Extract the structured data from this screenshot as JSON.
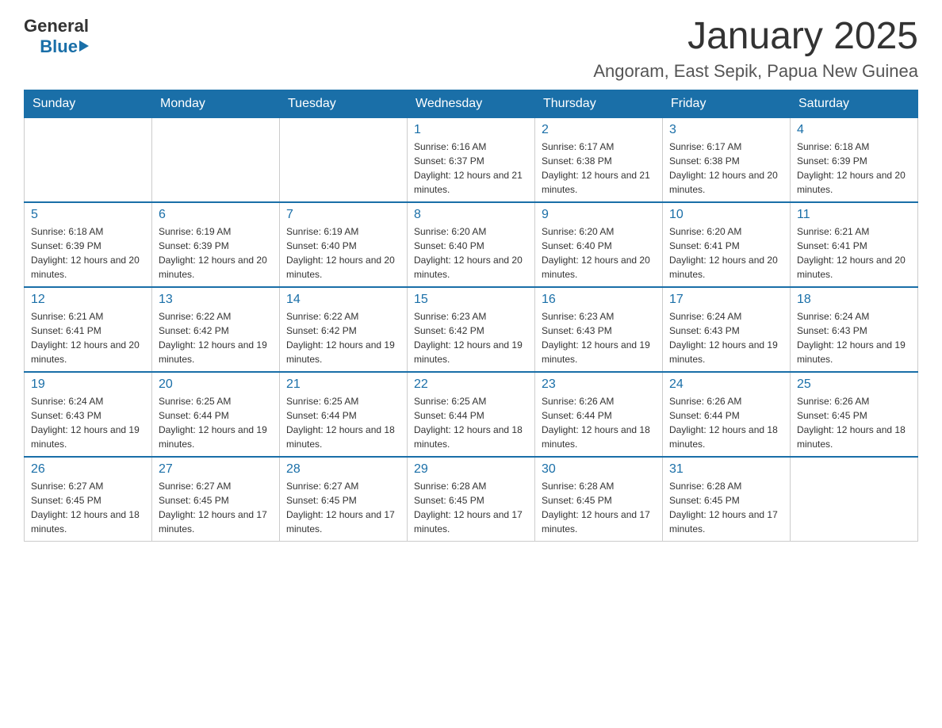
{
  "header": {
    "logo": {
      "general": "General",
      "blue": "Blue"
    },
    "title": "January 2025",
    "subtitle": "Angoram, East Sepik, Papua New Guinea"
  },
  "calendar": {
    "days_of_week": [
      "Sunday",
      "Monday",
      "Tuesday",
      "Wednesday",
      "Thursday",
      "Friday",
      "Saturday"
    ],
    "weeks": [
      [
        {
          "day": "",
          "info": ""
        },
        {
          "day": "",
          "info": ""
        },
        {
          "day": "",
          "info": ""
        },
        {
          "day": "1",
          "info": "Sunrise: 6:16 AM\nSunset: 6:37 PM\nDaylight: 12 hours and 21 minutes."
        },
        {
          "day": "2",
          "info": "Sunrise: 6:17 AM\nSunset: 6:38 PM\nDaylight: 12 hours and 21 minutes."
        },
        {
          "day": "3",
          "info": "Sunrise: 6:17 AM\nSunset: 6:38 PM\nDaylight: 12 hours and 20 minutes."
        },
        {
          "day": "4",
          "info": "Sunrise: 6:18 AM\nSunset: 6:39 PM\nDaylight: 12 hours and 20 minutes."
        }
      ],
      [
        {
          "day": "5",
          "info": "Sunrise: 6:18 AM\nSunset: 6:39 PM\nDaylight: 12 hours and 20 minutes."
        },
        {
          "day": "6",
          "info": "Sunrise: 6:19 AM\nSunset: 6:39 PM\nDaylight: 12 hours and 20 minutes."
        },
        {
          "day": "7",
          "info": "Sunrise: 6:19 AM\nSunset: 6:40 PM\nDaylight: 12 hours and 20 minutes."
        },
        {
          "day": "8",
          "info": "Sunrise: 6:20 AM\nSunset: 6:40 PM\nDaylight: 12 hours and 20 minutes."
        },
        {
          "day": "9",
          "info": "Sunrise: 6:20 AM\nSunset: 6:40 PM\nDaylight: 12 hours and 20 minutes."
        },
        {
          "day": "10",
          "info": "Sunrise: 6:20 AM\nSunset: 6:41 PM\nDaylight: 12 hours and 20 minutes."
        },
        {
          "day": "11",
          "info": "Sunrise: 6:21 AM\nSunset: 6:41 PM\nDaylight: 12 hours and 20 minutes."
        }
      ],
      [
        {
          "day": "12",
          "info": "Sunrise: 6:21 AM\nSunset: 6:41 PM\nDaylight: 12 hours and 20 minutes."
        },
        {
          "day": "13",
          "info": "Sunrise: 6:22 AM\nSunset: 6:42 PM\nDaylight: 12 hours and 19 minutes."
        },
        {
          "day": "14",
          "info": "Sunrise: 6:22 AM\nSunset: 6:42 PM\nDaylight: 12 hours and 19 minutes."
        },
        {
          "day": "15",
          "info": "Sunrise: 6:23 AM\nSunset: 6:42 PM\nDaylight: 12 hours and 19 minutes."
        },
        {
          "day": "16",
          "info": "Sunrise: 6:23 AM\nSunset: 6:43 PM\nDaylight: 12 hours and 19 minutes."
        },
        {
          "day": "17",
          "info": "Sunrise: 6:24 AM\nSunset: 6:43 PM\nDaylight: 12 hours and 19 minutes."
        },
        {
          "day": "18",
          "info": "Sunrise: 6:24 AM\nSunset: 6:43 PM\nDaylight: 12 hours and 19 minutes."
        }
      ],
      [
        {
          "day": "19",
          "info": "Sunrise: 6:24 AM\nSunset: 6:43 PM\nDaylight: 12 hours and 19 minutes."
        },
        {
          "day": "20",
          "info": "Sunrise: 6:25 AM\nSunset: 6:44 PM\nDaylight: 12 hours and 19 minutes."
        },
        {
          "day": "21",
          "info": "Sunrise: 6:25 AM\nSunset: 6:44 PM\nDaylight: 12 hours and 18 minutes."
        },
        {
          "day": "22",
          "info": "Sunrise: 6:25 AM\nSunset: 6:44 PM\nDaylight: 12 hours and 18 minutes."
        },
        {
          "day": "23",
          "info": "Sunrise: 6:26 AM\nSunset: 6:44 PM\nDaylight: 12 hours and 18 minutes."
        },
        {
          "day": "24",
          "info": "Sunrise: 6:26 AM\nSunset: 6:44 PM\nDaylight: 12 hours and 18 minutes."
        },
        {
          "day": "25",
          "info": "Sunrise: 6:26 AM\nSunset: 6:45 PM\nDaylight: 12 hours and 18 minutes."
        }
      ],
      [
        {
          "day": "26",
          "info": "Sunrise: 6:27 AM\nSunset: 6:45 PM\nDaylight: 12 hours and 18 minutes."
        },
        {
          "day": "27",
          "info": "Sunrise: 6:27 AM\nSunset: 6:45 PM\nDaylight: 12 hours and 17 minutes."
        },
        {
          "day": "28",
          "info": "Sunrise: 6:27 AM\nSunset: 6:45 PM\nDaylight: 12 hours and 17 minutes."
        },
        {
          "day": "29",
          "info": "Sunrise: 6:28 AM\nSunset: 6:45 PM\nDaylight: 12 hours and 17 minutes."
        },
        {
          "day": "30",
          "info": "Sunrise: 6:28 AM\nSunset: 6:45 PM\nDaylight: 12 hours and 17 minutes."
        },
        {
          "day": "31",
          "info": "Sunrise: 6:28 AM\nSunset: 6:45 PM\nDaylight: 12 hours and 17 minutes."
        },
        {
          "day": "",
          "info": ""
        }
      ]
    ]
  }
}
